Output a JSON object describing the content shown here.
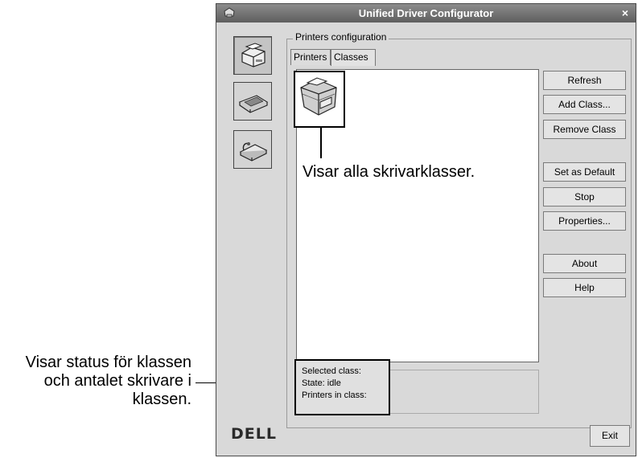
{
  "window": {
    "title": "Unified Driver Configurator",
    "close_glyph": "×"
  },
  "sidebar": {
    "items": [
      {
        "name": "printers",
        "icon": "printer-icon",
        "active": true
      },
      {
        "name": "scanners",
        "icon": "scanner-icon",
        "active": false
      },
      {
        "name": "ports",
        "icon": "port-icon",
        "active": false
      }
    ]
  },
  "group": {
    "title": "Printers configuration"
  },
  "tabs": [
    {
      "label": "Printers",
      "active": false
    },
    {
      "label": "Classes",
      "active": true
    }
  ],
  "buttons": {
    "refresh": "Refresh",
    "add_class": "Add Class...",
    "remove_class": "Remove Class",
    "set_default": "Set as Default",
    "stop": "Stop",
    "properties": "Properties...",
    "about": "About",
    "help": "Help",
    "exit": "Exit"
  },
  "status": {
    "selected_class": "Selected class:",
    "state": "State: idle",
    "printers_in_class": "Printers in class:"
  },
  "brand": {
    "logo": "DELL"
  },
  "annotations": {
    "classes_list": "Visar alla skrivarklasser.",
    "status_lines": [
      "Visar status för klassen",
      "och antalet skrivare i",
      "klassen."
    ]
  }
}
